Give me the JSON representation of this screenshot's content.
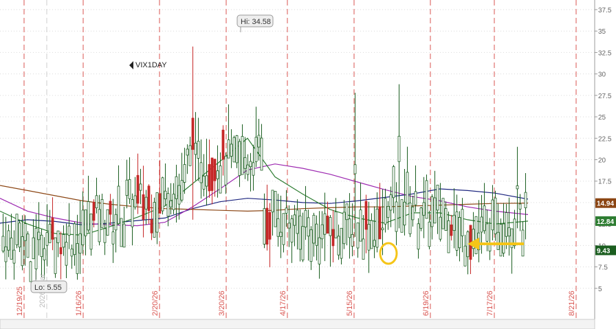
{
  "chart_data": {
    "type": "candlestick",
    "symbol": "VIX1DAY",
    "ylim": [
      2.5,
      37.5
    ],
    "y_ticks": [
      5,
      7.5,
      10,
      12.5,
      15,
      17.5,
      20,
      22.5,
      25,
      27.5,
      30,
      32.5,
      35,
      37.5
    ],
    "y_tick_labels": [
      "5",
      "7.5",
      "10",
      "12.5",
      "15",
      "17.5",
      "20",
      "22.5",
      "25",
      "27.5",
      "30",
      "32.5",
      "35",
      "37.5"
    ],
    "x_dates": [
      "12/19/25",
      "1/16/26",
      "2/20/26",
      "3/20/26",
      "4/17/26",
      "5/15/26",
      "6/19/26",
      "7/17/26",
      "8/21/26"
    ],
    "x_faded_label": "2026 Year",
    "grid": true,
    "annotations": {
      "high": "Hi: 34.58",
      "low": "Lo: 5.55"
    },
    "price_badges": [
      {
        "label": "14.94",
        "value": 14.94,
        "color": "#8B4513"
      },
      {
        "label": "12.84",
        "value": 12.84,
        "color": "#2e7d32"
      },
      {
        "label": "9.43",
        "value": 9.43,
        "color": "#1b5e20"
      }
    ],
    "series": [
      {
        "name": "",
        "color": "#1a237e",
        "values": [
          [
            0,
            12.6
          ],
          [
            40,
            13
          ],
          [
            80,
            12.8
          ],
          [
            120,
            12.4
          ],
          [
            160,
            12.6
          ],
          [
            200,
            12.9
          ],
          [
            240,
            13.2
          ],
          [
            280,
            14.3
          ],
          [
            320,
            15.1
          ],
          [
            360,
            15.5
          ],
          [
            400,
            15.3
          ],
          [
            440,
            15
          ],
          [
            480,
            14.9
          ],
          [
            520,
            15.2
          ],
          [
            560,
            15.6
          ],
          [
            600,
            16
          ],
          [
            640,
            16.6
          ],
          [
            680,
            16.4
          ],
          [
            720,
            16.1
          ],
          [
            768,
            15.4
          ]
        ]
      },
      {
        "name": "",
        "color": "#8B4513",
        "values": [
          [
            0,
            17
          ],
          [
            40,
            16.4
          ],
          [
            80,
            15.8
          ],
          [
            120,
            15.2
          ],
          [
            160,
            14.8
          ],
          [
            200,
            14.5
          ],
          [
            240,
            14.3
          ],
          [
            280,
            14.2
          ],
          [
            320,
            14.1
          ],
          [
            360,
            14
          ],
          [
            400,
            14.1
          ],
          [
            440,
            14.3
          ],
          [
            480,
            14.4
          ],
          [
            520,
            14.5
          ],
          [
            560,
            14.5
          ],
          [
            600,
            14.6
          ],
          [
            640,
            14.7
          ],
          [
            680,
            14.8
          ],
          [
            720,
            14.9
          ],
          [
            768,
            14.94
          ]
        ]
      },
      {
        "name": "",
        "color": "#9c27b0",
        "values": [
          [
            0,
            15.5
          ],
          [
            40,
            14
          ],
          [
            80,
            13.2
          ],
          [
            120,
            12.6
          ],
          [
            160,
            12.4
          ],
          [
            200,
            12.3
          ],
          [
            240,
            12.7
          ],
          [
            280,
            14.5
          ],
          [
            320,
            16.6
          ],
          [
            360,
            18.8
          ],
          [
            400,
            19.5
          ],
          [
            440,
            19
          ],
          [
            480,
            18.3
          ],
          [
            520,
            17.4
          ],
          [
            560,
            16.5
          ],
          [
            600,
            15.7
          ],
          [
            640,
            15.2
          ],
          [
            680,
            14.5
          ],
          [
            720,
            14
          ],
          [
            768,
            13.6
          ]
        ]
      },
      {
        "name": "",
        "color": "#2e7d32",
        "values": [
          [
            0,
            14
          ],
          [
            40,
            12.5
          ],
          [
            80,
            11.4
          ],
          [
            120,
            11.2
          ],
          [
            160,
            12.2
          ],
          [
            200,
            13.3
          ],
          [
            240,
            14.6
          ],
          [
            280,
            17.2
          ],
          [
            320,
            19.8
          ],
          [
            360,
            22.5
          ],
          [
            400,
            18
          ],
          [
            440,
            16
          ],
          [
            480,
            14.2
          ],
          [
            520,
            13.2
          ],
          [
            560,
            12.6
          ],
          [
            600,
            13.8
          ],
          [
            640,
            13.8
          ],
          [
            680,
            13
          ],
          [
            720,
            12.5
          ],
          [
            768,
            12.84
          ]
        ]
      }
    ],
    "last_value": 9.43
  }
}
